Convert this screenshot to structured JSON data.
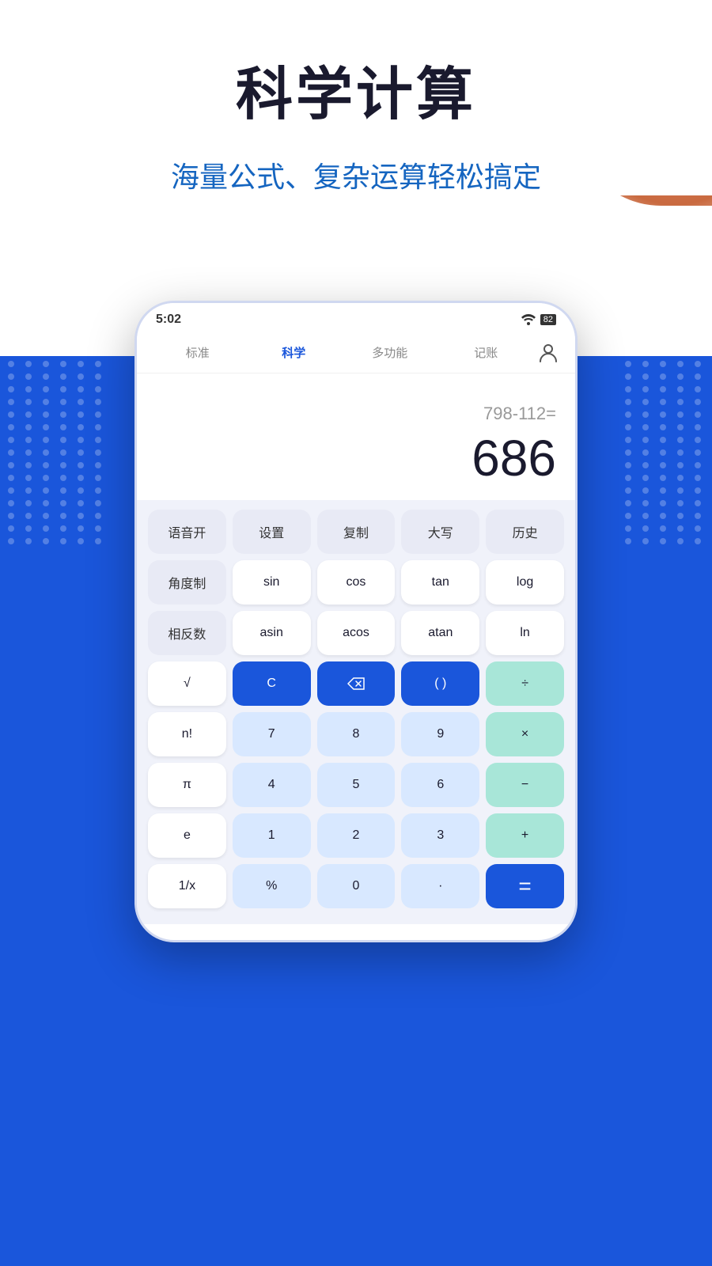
{
  "header": {
    "main_title": "科学计算",
    "sub_title": "海量公式、复杂运算轻松搞定"
  },
  "status_bar": {
    "time": "5:02",
    "battery": "82"
  },
  "tabs": [
    {
      "label": "标准",
      "active": false
    },
    {
      "label": "科学",
      "active": true
    },
    {
      "label": "多功能",
      "active": false
    },
    {
      "label": "记账",
      "active": false
    }
  ],
  "display": {
    "expression": "798-112=",
    "result": "686"
  },
  "buttons": {
    "row1": [
      "语音开",
      "设置",
      "复制",
      "大写",
      "历史"
    ],
    "row2": [
      "角度制",
      "sin",
      "cos",
      "tan",
      "log"
    ],
    "row3": [
      "相反数",
      "asin",
      "acos",
      "atan",
      "ln"
    ],
    "row4": [
      "√",
      "C",
      "⌫",
      "( )",
      "÷"
    ],
    "row5": [
      "n!",
      "7",
      "8",
      "9",
      "×"
    ],
    "row6": [
      "π",
      "4",
      "5",
      "6",
      "−"
    ],
    "row7": [
      "e",
      "1",
      "2",
      "3",
      "+"
    ],
    "row8": [
      "1/x",
      "%",
      "0",
      "·",
      "="
    ]
  }
}
